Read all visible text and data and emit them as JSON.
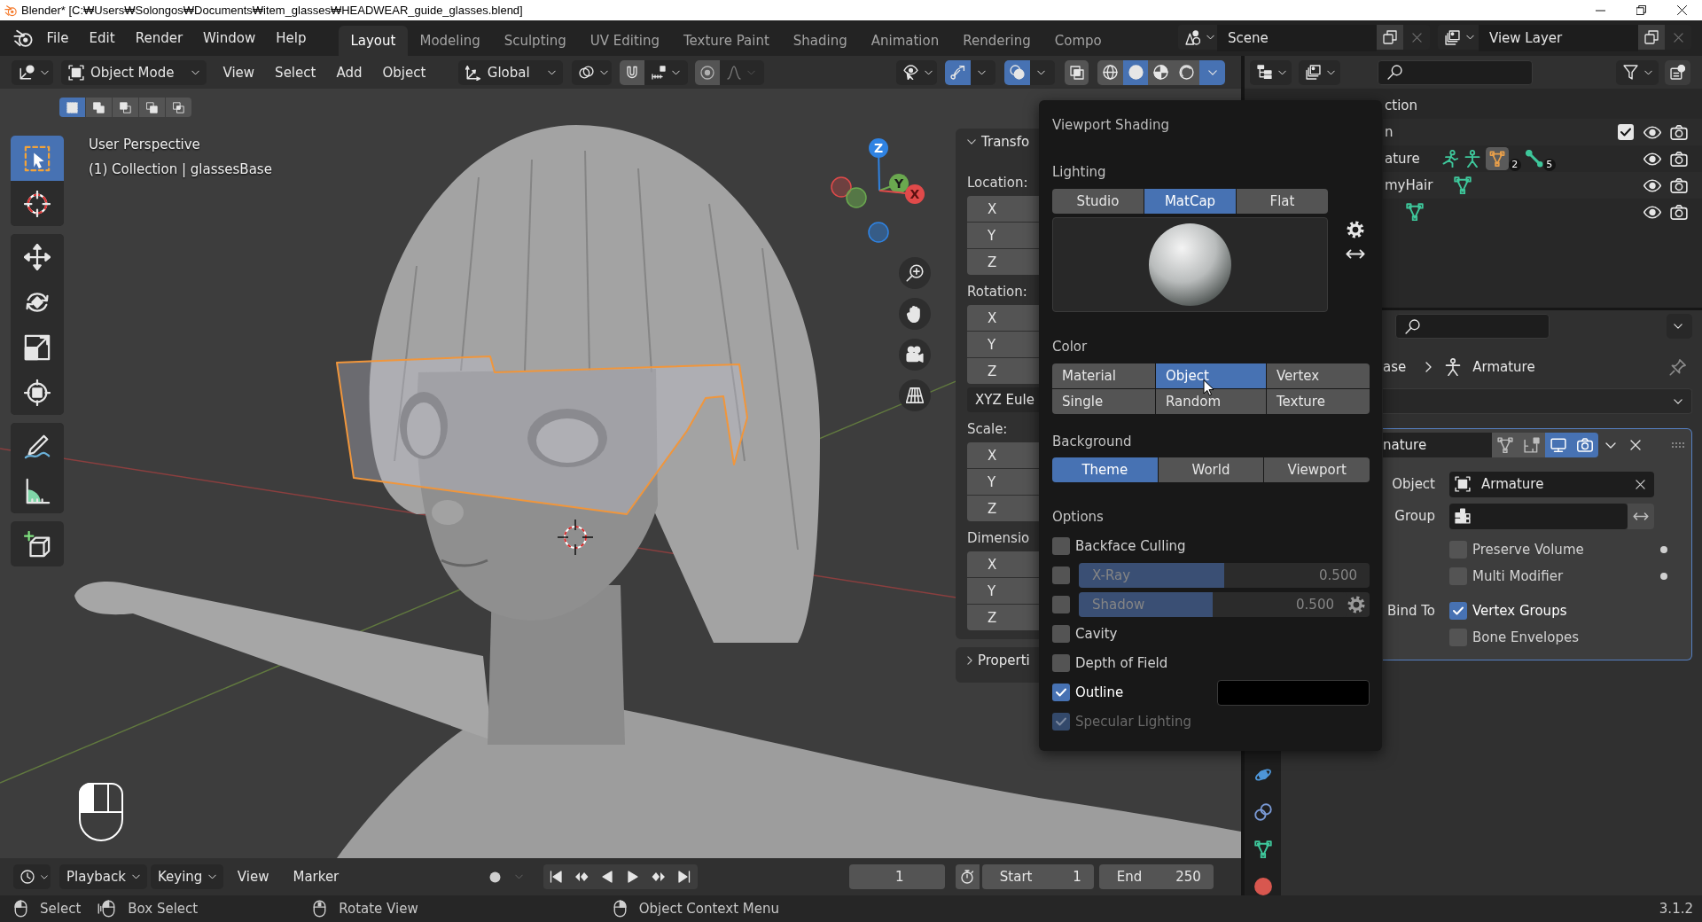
{
  "title_bar": {
    "title": "Blender* [C:₩Users₩Solongos₩Documents₩item_glasses₩HEADWEAR_guide_glasses.blend]"
  },
  "top_bar": {
    "menus": [
      "File",
      "Edit",
      "Render",
      "Window",
      "Help"
    ],
    "workspaces": [
      {
        "label": "Layout",
        "selected": true
      },
      {
        "label": "Modeling",
        "selected": false
      },
      {
        "label": "Sculpting",
        "selected": false
      },
      {
        "label": "UV Editing",
        "selected": false
      },
      {
        "label": "Texture Paint",
        "selected": false
      },
      {
        "label": "Shading",
        "selected": false
      },
      {
        "label": "Animation",
        "selected": false
      },
      {
        "label": "Rendering",
        "selected": false
      },
      {
        "label": "Compo",
        "selected": false
      }
    ],
    "scene": "Scene",
    "view_layer": "View Layer"
  },
  "viewport_header": {
    "mode": "Object Mode",
    "menus": [
      "View",
      "Select",
      "Add",
      "Object"
    ],
    "orientation": "Global",
    "snap_on": false,
    "proportional_on": false,
    "gizmos_on": true,
    "overlays_on": true,
    "xray_on": false,
    "shading_modes": [
      {
        "kind": "wireframe",
        "selected": false
      },
      {
        "kind": "solid",
        "selected": true
      },
      {
        "kind": "material",
        "selected": false
      },
      {
        "kind": "rendered",
        "selected": false
      }
    ],
    "shading_menu_open": true
  },
  "viewport": {
    "select_modes": [
      {
        "kind": "set",
        "selected": true
      },
      {
        "kind": "extend",
        "selected": false
      },
      {
        "kind": "subtract",
        "selected": false
      },
      {
        "kind": "difference",
        "selected": false
      },
      {
        "kind": "intersect",
        "selected": false
      }
    ],
    "tool_groups": [
      [
        {
          "kind": "select_box",
          "selected": true
        },
        {
          "kind": "cursor",
          "selected": false
        }
      ],
      [
        {
          "kind": "move",
          "selected": false
        },
        {
          "kind": "rotate",
          "selected": false
        },
        {
          "kind": "scale",
          "selected": false
        },
        {
          "kind": "transform",
          "selected": false
        }
      ],
      [
        {
          "kind": "annotate",
          "selected": false
        },
        {
          "kind": "measure",
          "selected": false
        }
      ],
      [
        {
          "kind": "add_cube",
          "selected": false
        }
      ]
    ],
    "view_name": "User Perspective",
    "info": "(1) Collection | glassesBase",
    "gizmo_axes": [
      {
        "kind": "z",
        "label": "Z"
      },
      {
        "kind": "y",
        "label": "Y"
      },
      {
        "kind": "x",
        "label": "X"
      }
    ]
  },
  "sidebar": {
    "panels": [
      {
        "title": "Transfo",
        "expanded": true,
        "groups": [
          {
            "label": "Location:",
            "fields": [
              "X",
              "Y",
              "Z"
            ]
          },
          {
            "label": "Rotation:",
            "fields": [
              "X",
              "Y",
              "Z"
            ],
            "mode": "XYZ Eule"
          },
          {
            "label": "Scale:",
            "fields": [
              "X",
              "Y",
              "Z"
            ]
          },
          {
            "label": "Dimensio",
            "fields": [
              "X",
              "Y",
              "Z"
            ]
          }
        ]
      },
      {
        "title": "Properti",
        "expanded": false
      }
    ]
  },
  "shading_popup": {
    "title": "Viewport Shading",
    "lighting": {
      "label": "Lighting",
      "options": [
        {
          "label": "Studio",
          "selected": false
        },
        {
          "label": "MatCap",
          "selected": true
        },
        {
          "label": "Flat",
          "selected": false
        }
      ]
    },
    "color": {
      "label": "Color",
      "options": [
        {
          "label": "Material",
          "selected": false
        },
        {
          "label": "Object",
          "selected": true
        },
        {
          "label": "Vertex",
          "selected": false
        },
        {
          "label": "Single",
          "selected": false
        },
        {
          "label": "Random",
          "selected": false
        },
        {
          "label": "Texture",
          "selected": false
        }
      ]
    },
    "background": {
      "label": "Background",
      "options": [
        {
          "label": "Theme",
          "selected": true
        },
        {
          "label": "World",
          "selected": false
        },
        {
          "label": "Viewport",
          "selected": false
        }
      ]
    },
    "options": {
      "label": "Options",
      "items": [
        {
          "kind": "check",
          "label": "Backface Culling",
          "checked": false,
          "disabled": false
        },
        {
          "kind": "slider",
          "label": "X-Ray",
          "checked": false,
          "disabled": false,
          "level": 0.5,
          "reading": "0.500"
        },
        {
          "kind": "slider_gear",
          "label": "Shadow",
          "checked": false,
          "disabled": false,
          "level": 0.5,
          "reading": "0.500"
        },
        {
          "kind": "check",
          "label": "Cavity",
          "checked": false,
          "disabled": false
        },
        {
          "kind": "check",
          "label": "Depth of Field",
          "checked": false,
          "disabled": false
        },
        {
          "kind": "color_check",
          "label": "Outline",
          "checked": true,
          "disabled": false
        },
        {
          "kind": "check",
          "label": "Specular Lighting",
          "checked": true,
          "disabled": true
        }
      ]
    }
  },
  "outliner": {
    "rows": [
      {
        "name": "ction"
      },
      {
        "name": "n",
        "checked": true,
        "visible": true,
        "renderable": true
      },
      {
        "name": "ature",
        "icons": [
          {
            "kind": "pose",
            "active": false
          },
          {
            "kind": "armature",
            "active": false
          },
          {
            "kind": "mesh",
            "active": true,
            "badge": "2"
          },
          {
            "kind": "bone",
            "active": false,
            "badge": "5"
          }
        ],
        "visible": true,
        "renderable": true
      },
      {
        "name": "myHair",
        "icons": [
          {
            "kind": "mesh",
            "active": false
          }
        ],
        "visible": true,
        "renderable": true
      },
      {
        "icons": [
          {
            "kind": "mesh",
            "active": false
          }
        ],
        "visible": true,
        "renderable": true
      }
    ]
  },
  "properties": {
    "tabs": [
      {
        "kind": "physics",
        "selected": false
      },
      {
        "kind": "constraints",
        "selected": false
      },
      {
        "kind": "data",
        "selected": false
      },
      {
        "kind": "material",
        "selected": false
      }
    ],
    "breadcrumb": [
      {
        "kind": "object",
        "label": "ase"
      },
      {
        "kind": "modifier",
        "label": "Armature"
      }
    ],
    "modifier": {
      "name": "nature",
      "active": true,
      "toggles": [
        {
          "kind": "edit_mode",
          "on": false
        },
        {
          "kind": "cage",
          "on": false
        },
        {
          "kind": "realtime",
          "on": true
        },
        {
          "kind": "render",
          "on": true
        }
      ],
      "fields": [
        {
          "kind": "object",
          "label": "Object",
          "value": "Armature"
        },
        {
          "kind": "vertex_group",
          "label": "Group"
        }
      ],
      "options": [
        {
          "label": "Preserve Volume",
          "checked": false,
          "decorated": true
        },
        {
          "label": "Multi Modifier",
          "checked": false,
          "decorated": true
        }
      ],
      "bind_to": {
        "label": "Bind To",
        "options": [
          {
            "label": "Vertex Groups",
            "checked": true
          },
          {
            "label": "Bone Envelopes",
            "checked": false
          }
        ]
      }
    }
  },
  "timeline": {
    "menus": [
      {
        "kind": "dropdown",
        "label": "Playback"
      },
      {
        "kind": "dropdown",
        "label": "Keying"
      },
      {
        "kind": "menu",
        "label": "View"
      },
      {
        "kind": "menu",
        "label": "Marker"
      }
    ],
    "auto_keying": false,
    "current_frame": "1",
    "preview_range_on": false,
    "start": {
      "label": "Start",
      "value": "1"
    },
    "end": {
      "label": "End",
      "value": "250"
    }
  },
  "status_bar": {
    "hints": [
      {
        "kind": "left_click",
        "label": "Select"
      },
      {
        "kind": "left_drag",
        "label": "Box Select"
      },
      {
        "kind": "middle_drag",
        "label": "Rotate View"
      },
      {
        "kind": "right_click",
        "label": "Object Context Menu"
      }
    ],
    "version": "3.1.2"
  }
}
